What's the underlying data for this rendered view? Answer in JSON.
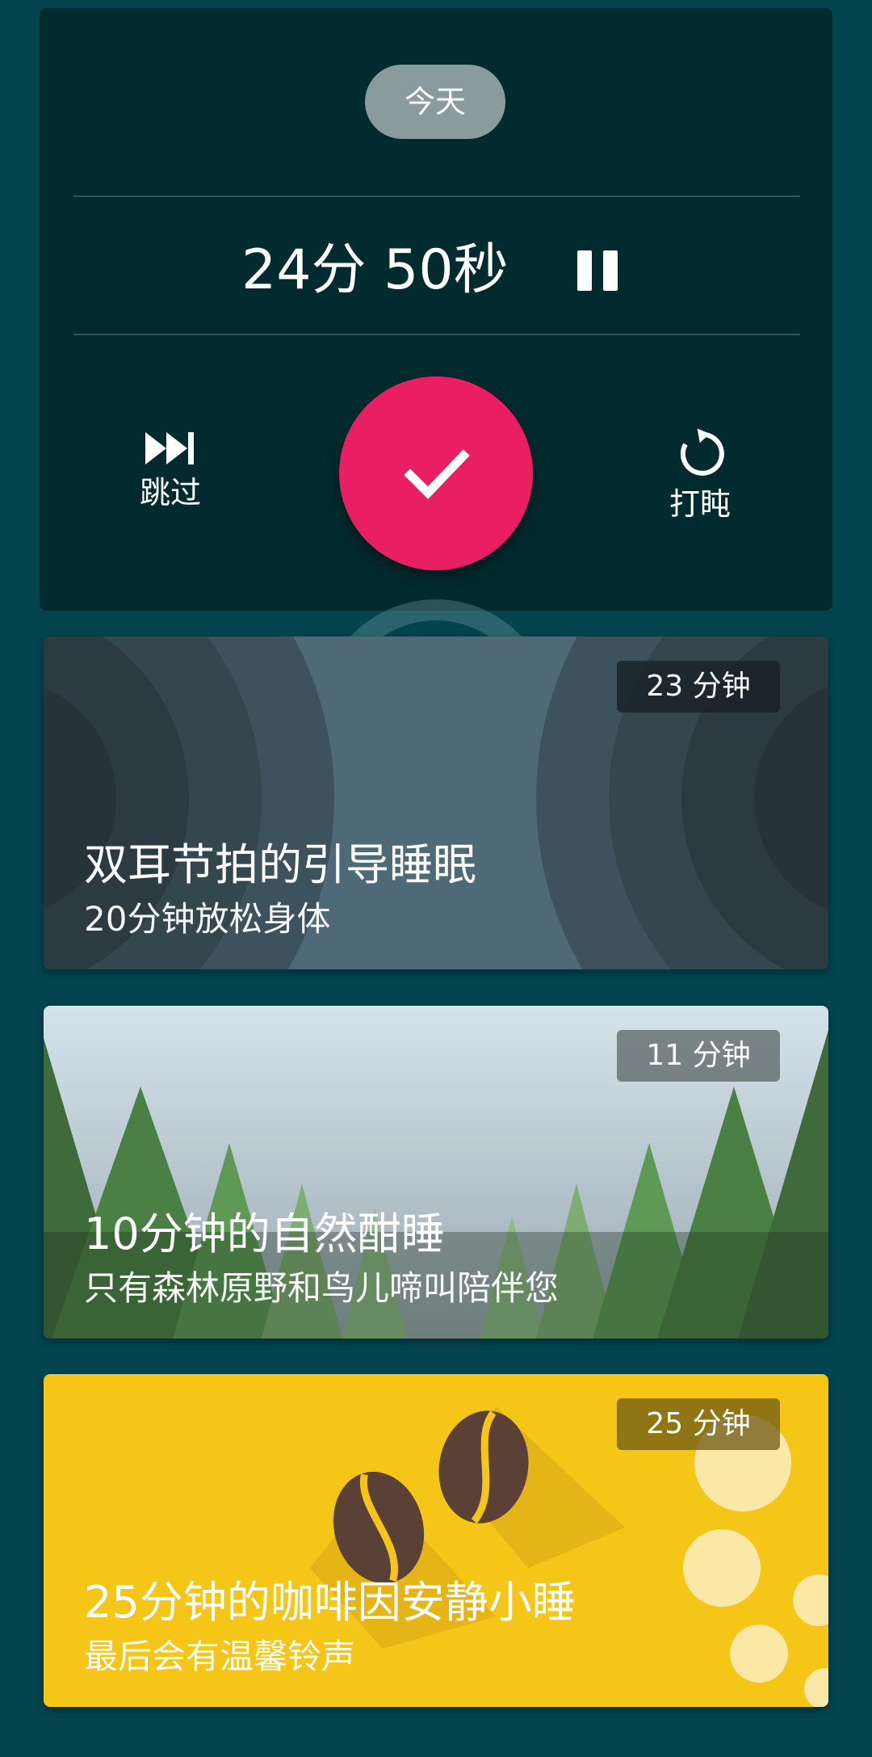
{
  "timer": {
    "date_pill": "今天",
    "remaining": "24分 50秒",
    "skip_label": "跳过",
    "snooze_label": "打盹"
  },
  "cards": [
    {
      "duration": "23 分钟",
      "title": "双耳节拍的引导睡眠",
      "subtitle": "20分钟放松身体",
      "theme": "sound-waves",
      "bg_color": "#4e6a76"
    },
    {
      "duration": "11 分钟",
      "title": "10分钟的自然酣睡",
      "subtitle": "只有森林原野和鸟儿啼叫陪伴您",
      "theme": "forest",
      "bg_color": "#b7c8cf"
    },
    {
      "duration": "25 分钟",
      "title": "25分钟的咖啡因安静小睡",
      "subtitle": "最后会有温馨铃声",
      "theme": "coffee-beans",
      "bg_color": "#f5c518"
    }
  ],
  "colors": {
    "background": "#03444f",
    "timer_card": "#022b2f",
    "accent": "#e91e63"
  },
  "icons": {
    "pause": "pause-icon",
    "skip": "skip-next-icon",
    "snooze": "replay-icon",
    "done": "check-icon"
  }
}
